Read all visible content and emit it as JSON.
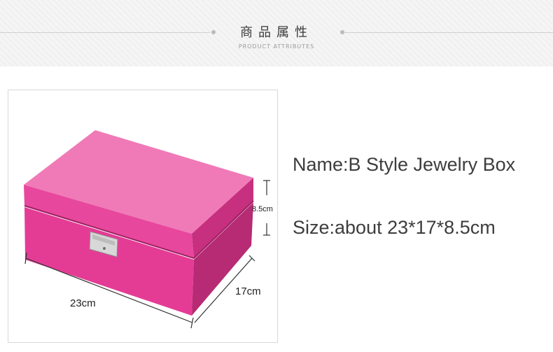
{
  "header": {
    "title": "商品属性",
    "subtitle": "PRODUCT ATTRIBUTES"
  },
  "product_image": {
    "box_color": "#e8409a",
    "dimensions": {
      "width_label": "23cm",
      "depth_label": "17cm",
      "height_label": "8.5cm"
    }
  },
  "info": {
    "name": "Name:B Style Jewelry Box",
    "size": "Size:about 23*17*8.5cm"
  }
}
